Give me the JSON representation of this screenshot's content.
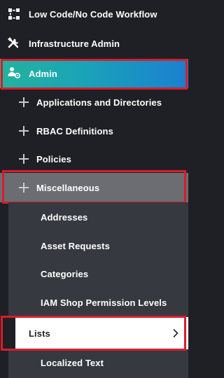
{
  "menu": {
    "top_items": [
      {
        "label": "Low Code/No Code Workflow",
        "icon": "workflow-icon"
      },
      {
        "label": "Infrastructure Admin",
        "icon": "tools-icon"
      }
    ],
    "admin": {
      "label": "Admin",
      "icon": "admin-users-gear-icon"
    },
    "admin_children": [
      {
        "label": "Applications and Directories"
      },
      {
        "label": "RBAC Definitions"
      },
      {
        "label": "Policies"
      },
      {
        "label": "Miscellaneous"
      }
    ],
    "misc_children": [
      {
        "label": "Addresses"
      },
      {
        "label": "Asset Requests"
      },
      {
        "label": "Categories"
      },
      {
        "label": "IAM Shop Permission Levels"
      },
      {
        "label": "Lists"
      },
      {
        "label": "Localized Text"
      }
    ]
  },
  "colors": {
    "background": "#1f2025",
    "admin_gradient_start": "#23b39f",
    "admin_gradient_end": "#1a7fd0",
    "highlight_box": "#d91d2a",
    "misc_active": "#6b6d72",
    "selected_item": "#ffffff"
  }
}
